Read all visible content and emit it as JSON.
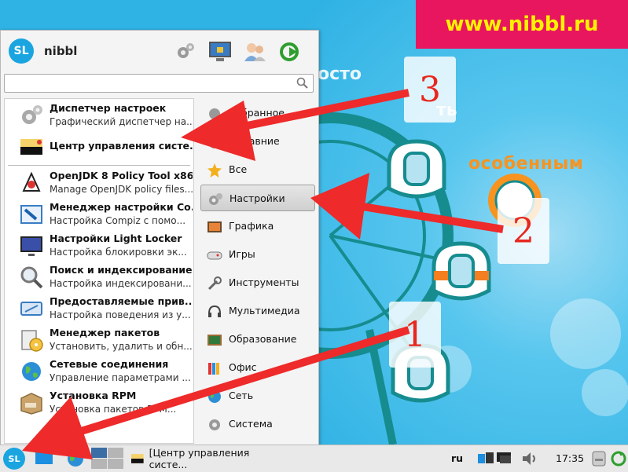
{
  "banner": {
    "text": "www.nibbl.ru"
  },
  "wallpaper": {
    "word1": "осто",
    "word2": "особенным",
    "word3": "ть"
  },
  "steps": [
    "3",
    "2",
    "1"
  ],
  "menu": {
    "user": "nibbl",
    "logo": "SL",
    "header_icons": [
      "gears-icon",
      "lock-monitor-icon",
      "users-icon",
      "logout-icon"
    ],
    "search": {
      "value": "",
      "placeholder": ""
    },
    "pinned": [
      {
        "title": "Диспетчер настроек",
        "desc": "Графический диспетчер на...",
        "icon": "gears-icon"
      },
      {
        "title": "Центр управления систе...",
        "desc": "",
        "icon": "basealt-icon"
      }
    ],
    "apps": [
      {
        "title": "OpenJDK 8 Policy Tool x86_64",
        "desc": "Manage OpenJDK policy files...",
        "icon": "java-icon"
      },
      {
        "title": "Менеджер настройки Co...",
        "desc": "Настройка Compiz с помо...",
        "icon": "compiz-icon"
      },
      {
        "title": "Настройки Light Locker",
        "desc": "Настройка блокировки эк...",
        "icon": "monitor-icon"
      },
      {
        "title": "Поиск и индексирование",
        "desc": "Настройка индексировани...",
        "icon": "magnifier-icon"
      },
      {
        "title": "Предоставляемые прив...",
        "desc": "Настройка поведения из у...",
        "icon": "device-icon"
      },
      {
        "title": "Менеджер пакетов",
        "desc": "Установить, удалить и обн...",
        "icon": "package-cd-icon"
      },
      {
        "title": "Сетевые соединения",
        "desc": "Управление параметрами ...",
        "icon": "globe-icon"
      },
      {
        "title": "Установка RPM",
        "desc": "Установка пакетов RPM...",
        "icon": "rpm-box-icon"
      }
    ],
    "categories": [
      {
        "label": "Избранное",
        "icon": "favorites-icon"
      },
      {
        "label": "Недавние",
        "icon": "recent-icon"
      },
      {
        "label": "Все",
        "icon": "star-icon"
      },
      {
        "label": "Настройки",
        "icon": "settings-icon",
        "selected": true
      },
      {
        "label": "Графика",
        "icon": "graphics-icon"
      },
      {
        "label": "Игры",
        "icon": "gamepad-icon"
      },
      {
        "label": "Инструменты",
        "icon": "tools-icon"
      },
      {
        "label": "Мультимедиа",
        "icon": "multimedia-icon"
      },
      {
        "label": "Образование",
        "icon": "education-icon"
      },
      {
        "label": "Офис",
        "icon": "office-icon"
      },
      {
        "label": "Сеть",
        "icon": "network-icon"
      },
      {
        "label": "Система",
        "icon": "system-icon"
      }
    ]
  },
  "taskbar": {
    "start_label": "SL",
    "window_title": "[Центр управления систе...",
    "lang": "ru",
    "clock": "17:35"
  },
  "colors": {
    "banner_bg": "#e8165f",
    "banner_text": "#fff200",
    "arrow": "#ee2a2a",
    "accent": "#1aa5e0"
  }
}
